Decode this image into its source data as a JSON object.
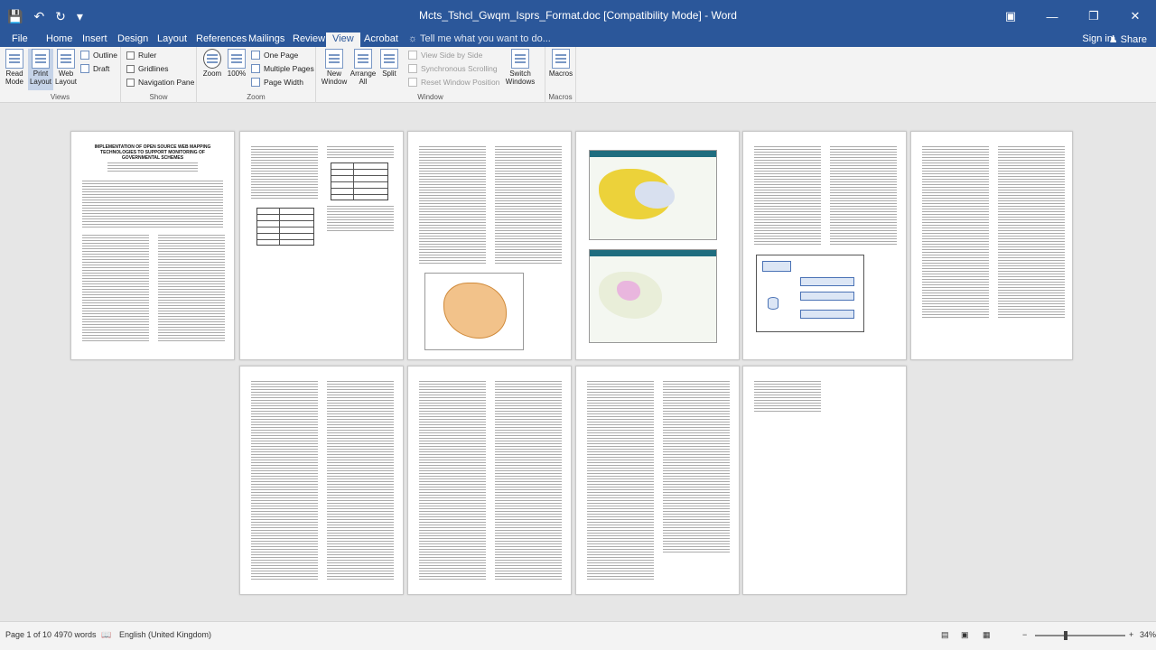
{
  "window": {
    "title": "Mcts_Tshcl_Gwqm_Isprs_Format.doc [Compatibility Mode] - Word",
    "quick_access": [
      "save-icon",
      "undo-icon",
      "redo-icon",
      "customize-icon"
    ],
    "controls": [
      "ribbon-display-icon",
      "minimize-icon",
      "restore-icon",
      "close-icon"
    ]
  },
  "tabs": [
    "File",
    "Home",
    "Insert",
    "Design",
    "Layout",
    "References",
    "Mailings",
    "Review",
    "View",
    "Acrobat"
  ],
  "active_tab": "View",
  "tell_me": "Tell me what you want to do...",
  "sign_in": "Sign in",
  "share": "Share",
  "ribbon": {
    "views": {
      "label": "Views",
      "read_mode": "Read Mode",
      "print_layout": "Print Layout",
      "web_layout": "Web Layout",
      "outline": "Outline",
      "draft": "Draft"
    },
    "show": {
      "label": "Show",
      "ruler": "Ruler",
      "gridlines": "Gridlines",
      "navigation_pane": "Navigation Pane"
    },
    "zoom": {
      "label": "Zoom",
      "zoom": "Zoom",
      "hundred": "100%",
      "one_page": "One Page",
      "multiple_pages": "Multiple Pages",
      "page_width": "Page Width"
    },
    "window": {
      "label": "Window",
      "new_window": "New Window",
      "arrange_all": "Arrange All",
      "split": "Split",
      "view_side_by_side": "View Side by Side",
      "synchronous_scrolling": "Synchronous Scrolling",
      "reset_window_position": "Reset Window Position",
      "switch_windows": "Switch Windows"
    },
    "macros": {
      "label": "Macros",
      "macros": "Macros"
    }
  },
  "document": {
    "page1_title": "IMPLEMENTATION OF OPEN SOURCE WEB MAPPING TECHNOLOGIES TO SUPPORT MONITORING OF GOVERNMENTAL SCHEMES",
    "page_count_shown": 10
  },
  "status": {
    "page": "Page 1 of 10",
    "words": "4970 words",
    "language": "English (United Kingdom)",
    "zoom": "34%",
    "zoom_percent": 34
  }
}
